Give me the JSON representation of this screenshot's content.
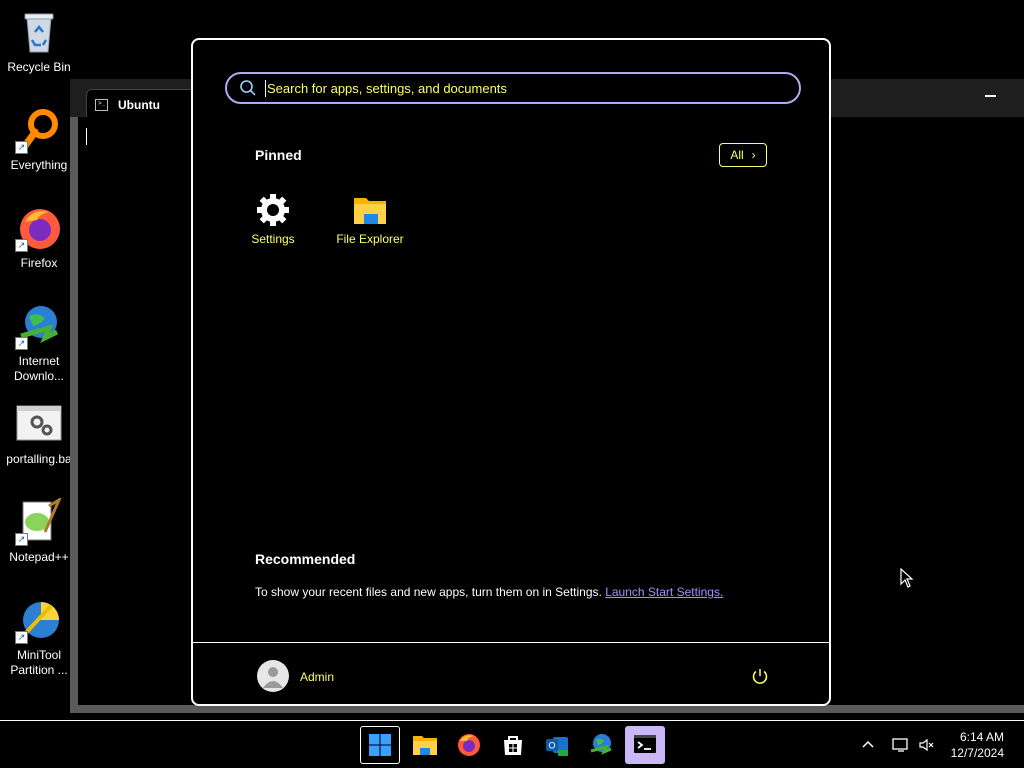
{
  "desktop": {
    "icons": [
      {
        "label": "Recycle Bin",
        "icon": "recycle-bin-icon"
      },
      {
        "label": "Everything",
        "icon": "everything-search-icon"
      },
      {
        "label": "Firefox",
        "icon": "firefox-icon"
      },
      {
        "label": "Internet Downlo...",
        "icon": "internet-download-manager-icon"
      },
      {
        "label": "portalling.ba",
        "icon": "batch-file-icon"
      },
      {
        "label": "Notepad++",
        "icon": "notepad-plus-plus-icon"
      },
      {
        "label": "MiniTool Partition ...",
        "icon": "minitool-partition-icon"
      }
    ]
  },
  "terminal": {
    "tab_title": "Ubuntu"
  },
  "start_menu": {
    "search": {
      "placeholder": "Search for apps, settings, and documents"
    },
    "pinned": {
      "title": "Pinned",
      "all_label": "All",
      "apps": [
        {
          "label": "Settings",
          "icon": "settings-gear-icon"
        },
        {
          "label": "File Explorer",
          "icon": "file-explorer-folder-icon"
        }
      ]
    },
    "recommended": {
      "title": "Recommended",
      "message": "To show your recent files and new apps, turn them on in Settings.",
      "link": "Launch Start Settings."
    },
    "user": {
      "name": "Admin"
    }
  },
  "taskbar": {
    "items": [
      "start-icon",
      "file-explorer-icon",
      "firefox-icon",
      "microsoft-store-icon",
      "outlook-new-icon",
      "internet-download-manager-icon",
      "terminal-icon"
    ],
    "clock": {
      "time": "6:14 AM",
      "date": "12/7/2024"
    }
  },
  "colors": {
    "accent_text": "#ffff66",
    "search_border": "#b9a6f0",
    "link": "#9e94ff",
    "taskbar_selected": "#c9b8f5"
  }
}
